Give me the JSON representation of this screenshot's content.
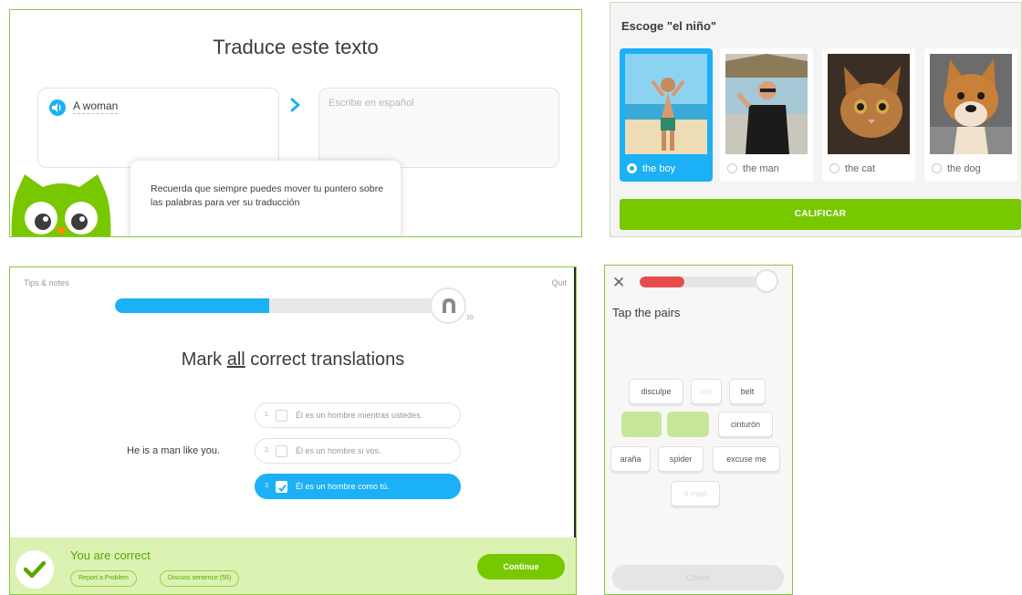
{
  "translate_panel": {
    "title": "Traduce este texto",
    "source_text": "A woman",
    "input_placeholder": "Escribe en español",
    "tip_text": "Recuerda que siempre puedes mover tu puntero sobre las palabras para ver su traducción",
    "icons": [
      "speaker-icon",
      "chevron-right-icon",
      "owl-mascot"
    ],
    "accent_color": "#1cb0f6"
  },
  "choose_panel": {
    "title": "Escoge \"el niño\"",
    "options": [
      {
        "label": "the boy",
        "selected": true
      },
      {
        "label": "the man",
        "selected": false
      },
      {
        "label": "the cat",
        "selected": false
      },
      {
        "label": "the dog",
        "selected": false
      }
    ],
    "submit_label": "CALIFICAR",
    "button_color": "#78c800"
  },
  "mark_panel": {
    "tips_label": "Tips & notes",
    "quit_label": "Quit",
    "progress_fraction": 0.47,
    "title_prefix": "Mark ",
    "title_emphasis": "all",
    "title_suffix": " correct translations",
    "sentence": "He is a man like you.",
    "answers": [
      {
        "num": "1.",
        "text": "Él es un hombre mientras ustedes.",
        "checked": false
      },
      {
        "num": "2.",
        "text": "Él es un hombre si vos.",
        "checked": false
      },
      {
        "num": "3.",
        "text": "Él es un hombre como tú.",
        "checked": true
      }
    ],
    "result_text": "You are correct",
    "report_label": "Report a Problem",
    "discuss_label": "Discuss sentence (55)",
    "continue_label": "Continue",
    "result_color": "#58a700"
  },
  "pairs_panel": {
    "close_glyph": "✕",
    "progress_fraction": 0.38,
    "title": "Tap the pairs",
    "tiles": {
      "disculpe": "disculpe",
      "leo": "leo",
      "belt": "belt",
      "matched_a": "",
      "matched_b": "",
      "cinturon": "cinturón",
      "arana": "araña",
      "spider": "spider",
      "excuse_me": "excuse me",
      "dim_bottom": "ti mad"
    },
    "check_label": "Check"
  }
}
